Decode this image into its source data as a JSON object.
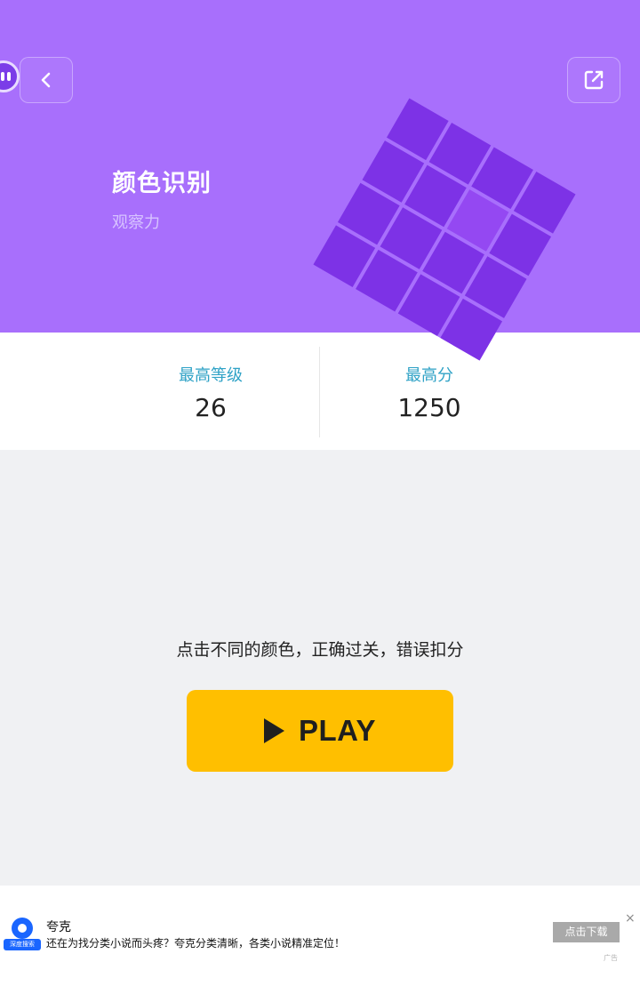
{
  "header": {
    "title": "颜色识别",
    "subtitle": "观察力",
    "background_color": "#a86ffc",
    "back_icon": "chevron-left-icon",
    "share_icon": "share-external-icon",
    "assistant_icon": "chat-bubble-icon"
  },
  "stats": {
    "best_level_label": "最高等级",
    "best_level_value": "26",
    "best_score_label": "最高分",
    "best_score_value": "1250"
  },
  "main": {
    "instruction": "点击不同的颜色，正确过关，错误扣分",
    "play_label": "PLAY",
    "play_icon": "play-icon",
    "play_color": "#ffbf00"
  },
  "ad": {
    "logo_text": "深度搜索",
    "title": "夸克",
    "description": "还在为找分类小说而头疼？夸克分类清晰，各类小说精准定位！",
    "button_label": "点击下载",
    "close_glyph": "×",
    "tag": "广告",
    "logo_color": "#1a66ff"
  }
}
